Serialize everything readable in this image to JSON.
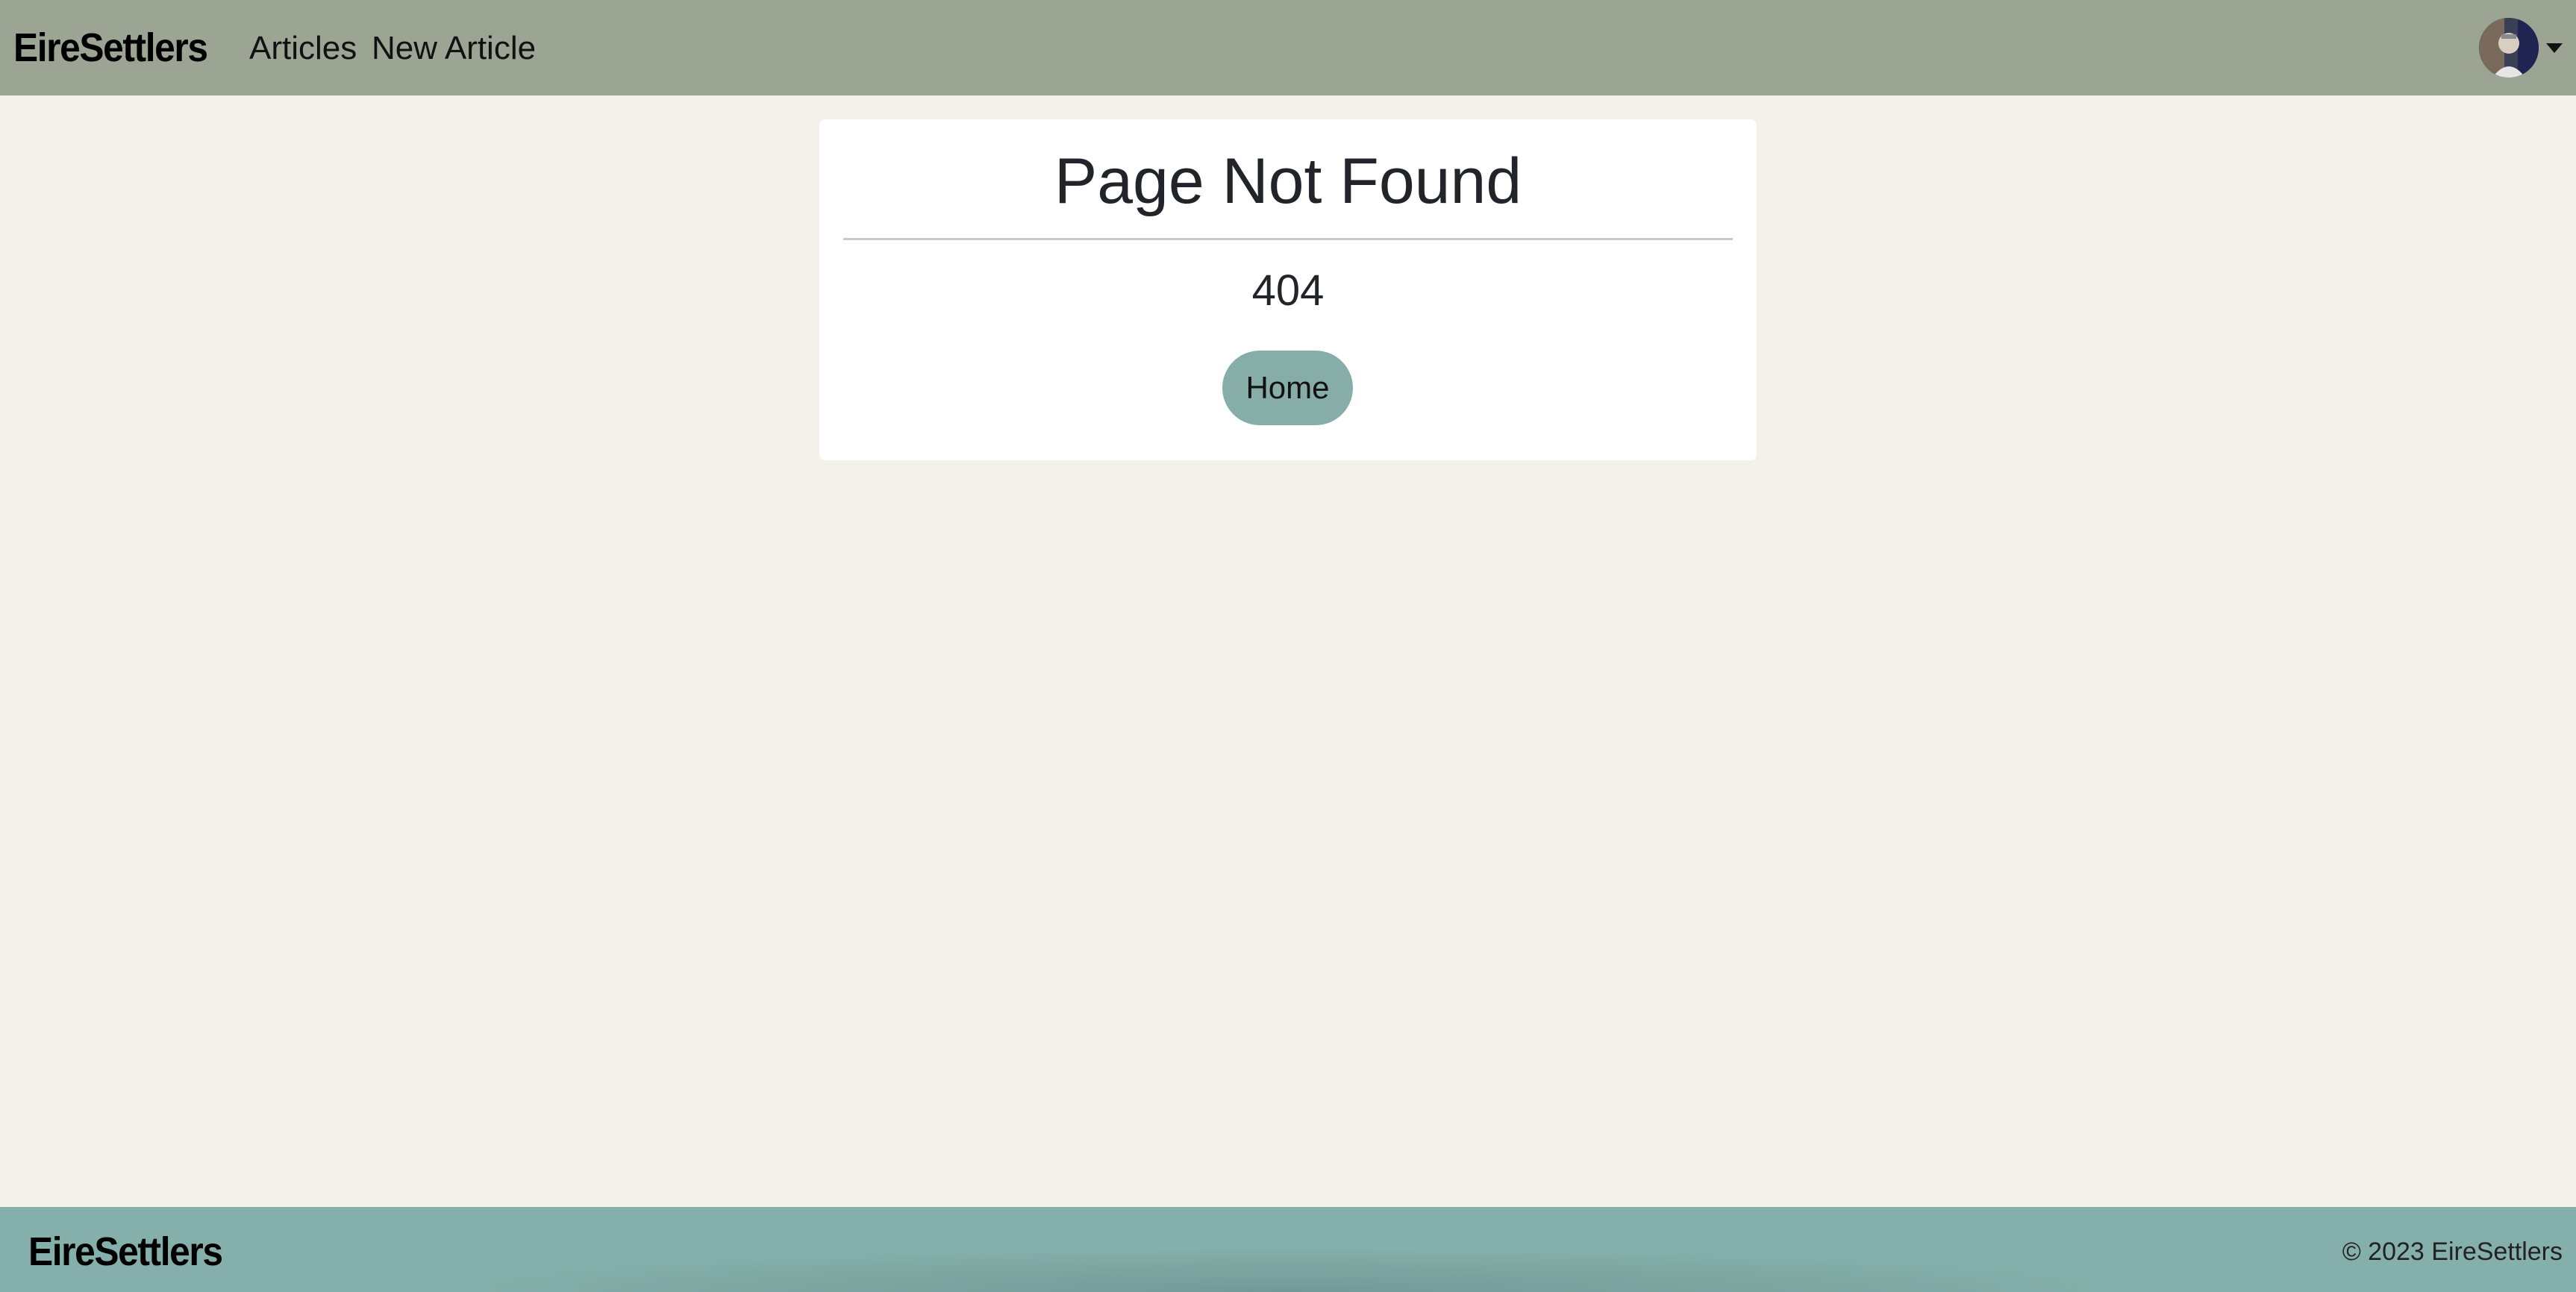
{
  "navbar": {
    "brand": "EireSettlers",
    "links": [
      {
        "label": "Articles"
      },
      {
        "label": "New Article"
      }
    ],
    "avatar": {
      "icon": "user-avatar",
      "caret_icon": "caret-down-icon"
    },
    "background_color": "#9ca593"
  },
  "card": {
    "title": "Page Not Found",
    "code": "404",
    "home_button_label": "Home",
    "button_color": "#86ada8"
  },
  "footer": {
    "brand": "EireSettlers",
    "copyright": "© 2023 EireSettlers",
    "background_color": "#85afaa"
  },
  "page": {
    "background_color": "#f4f1ea"
  }
}
